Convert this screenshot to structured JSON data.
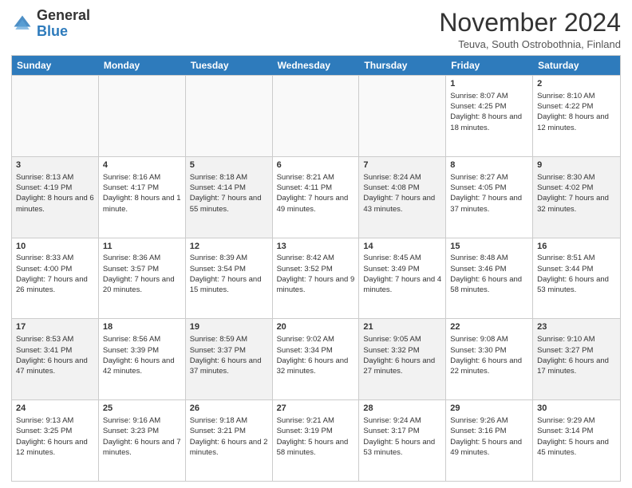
{
  "logo": {
    "general": "General",
    "blue": "Blue"
  },
  "title": "November 2024",
  "location": "Teuva, South Ostrobothnia, Finland",
  "days_of_week": [
    "Sunday",
    "Monday",
    "Tuesday",
    "Wednesday",
    "Thursday",
    "Friday",
    "Saturday"
  ],
  "rows": [
    [
      {
        "day": "",
        "info": "",
        "empty": true
      },
      {
        "day": "",
        "info": "",
        "empty": true
      },
      {
        "day": "",
        "info": "",
        "empty": true
      },
      {
        "day": "",
        "info": "",
        "empty": true
      },
      {
        "day": "",
        "info": "",
        "empty": true
      },
      {
        "day": "1",
        "info": "Sunrise: 8:07 AM\nSunset: 4:25 PM\nDaylight: 8 hours and 18 minutes.",
        "empty": false
      },
      {
        "day": "2",
        "info": "Sunrise: 8:10 AM\nSunset: 4:22 PM\nDaylight: 8 hours and 12 minutes.",
        "empty": false
      }
    ],
    [
      {
        "day": "3",
        "info": "Sunrise: 8:13 AM\nSunset: 4:19 PM\nDaylight: 8 hours and 6 minutes.",
        "empty": false
      },
      {
        "day": "4",
        "info": "Sunrise: 8:16 AM\nSunset: 4:17 PM\nDaylight: 8 hours and 1 minute.",
        "empty": false
      },
      {
        "day": "5",
        "info": "Sunrise: 8:18 AM\nSunset: 4:14 PM\nDaylight: 7 hours and 55 minutes.",
        "empty": false
      },
      {
        "day": "6",
        "info": "Sunrise: 8:21 AM\nSunset: 4:11 PM\nDaylight: 7 hours and 49 minutes.",
        "empty": false
      },
      {
        "day": "7",
        "info": "Sunrise: 8:24 AM\nSunset: 4:08 PM\nDaylight: 7 hours and 43 minutes.",
        "empty": false
      },
      {
        "day": "8",
        "info": "Sunrise: 8:27 AM\nSunset: 4:05 PM\nDaylight: 7 hours and 37 minutes.",
        "empty": false
      },
      {
        "day": "9",
        "info": "Sunrise: 8:30 AM\nSunset: 4:02 PM\nDaylight: 7 hours and 32 minutes.",
        "empty": false
      }
    ],
    [
      {
        "day": "10",
        "info": "Sunrise: 8:33 AM\nSunset: 4:00 PM\nDaylight: 7 hours and 26 minutes.",
        "empty": false
      },
      {
        "day": "11",
        "info": "Sunrise: 8:36 AM\nSunset: 3:57 PM\nDaylight: 7 hours and 20 minutes.",
        "empty": false
      },
      {
        "day": "12",
        "info": "Sunrise: 8:39 AM\nSunset: 3:54 PM\nDaylight: 7 hours and 15 minutes.",
        "empty": false
      },
      {
        "day": "13",
        "info": "Sunrise: 8:42 AM\nSunset: 3:52 PM\nDaylight: 7 hours and 9 minutes.",
        "empty": false
      },
      {
        "day": "14",
        "info": "Sunrise: 8:45 AM\nSunset: 3:49 PM\nDaylight: 7 hours and 4 minutes.",
        "empty": false
      },
      {
        "day": "15",
        "info": "Sunrise: 8:48 AM\nSunset: 3:46 PM\nDaylight: 6 hours and 58 minutes.",
        "empty": false
      },
      {
        "day": "16",
        "info": "Sunrise: 8:51 AM\nSunset: 3:44 PM\nDaylight: 6 hours and 53 minutes.",
        "empty": false
      }
    ],
    [
      {
        "day": "17",
        "info": "Sunrise: 8:53 AM\nSunset: 3:41 PM\nDaylight: 6 hours and 47 minutes.",
        "empty": false
      },
      {
        "day": "18",
        "info": "Sunrise: 8:56 AM\nSunset: 3:39 PM\nDaylight: 6 hours and 42 minutes.",
        "empty": false
      },
      {
        "day": "19",
        "info": "Sunrise: 8:59 AM\nSunset: 3:37 PM\nDaylight: 6 hours and 37 minutes.",
        "empty": false
      },
      {
        "day": "20",
        "info": "Sunrise: 9:02 AM\nSunset: 3:34 PM\nDaylight: 6 hours and 32 minutes.",
        "empty": false
      },
      {
        "day": "21",
        "info": "Sunrise: 9:05 AM\nSunset: 3:32 PM\nDaylight: 6 hours and 27 minutes.",
        "empty": false
      },
      {
        "day": "22",
        "info": "Sunrise: 9:08 AM\nSunset: 3:30 PM\nDaylight: 6 hours and 22 minutes.",
        "empty": false
      },
      {
        "day": "23",
        "info": "Sunrise: 9:10 AM\nSunset: 3:27 PM\nDaylight: 6 hours and 17 minutes.",
        "empty": false
      }
    ],
    [
      {
        "day": "24",
        "info": "Sunrise: 9:13 AM\nSunset: 3:25 PM\nDaylight: 6 hours and 12 minutes.",
        "empty": false
      },
      {
        "day": "25",
        "info": "Sunrise: 9:16 AM\nSunset: 3:23 PM\nDaylight: 6 hours and 7 minutes.",
        "empty": false
      },
      {
        "day": "26",
        "info": "Sunrise: 9:18 AM\nSunset: 3:21 PM\nDaylight: 6 hours and 2 minutes.",
        "empty": false
      },
      {
        "day": "27",
        "info": "Sunrise: 9:21 AM\nSunset: 3:19 PM\nDaylight: 5 hours and 58 minutes.",
        "empty": false
      },
      {
        "day": "28",
        "info": "Sunrise: 9:24 AM\nSunset: 3:17 PM\nDaylight: 5 hours and 53 minutes.",
        "empty": false
      },
      {
        "day": "29",
        "info": "Sunrise: 9:26 AM\nSunset: 3:16 PM\nDaylight: 5 hours and 49 minutes.",
        "empty": false
      },
      {
        "day": "30",
        "info": "Sunrise: 9:29 AM\nSunset: 3:14 PM\nDaylight: 5 hours and 45 minutes.",
        "empty": false
      }
    ]
  ]
}
